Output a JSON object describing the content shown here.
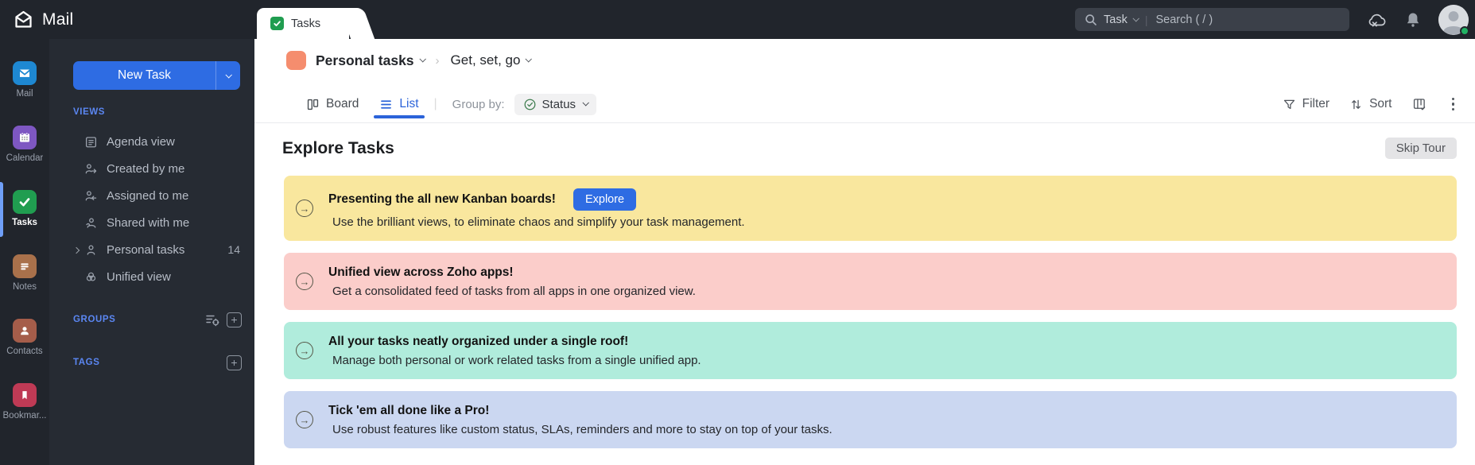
{
  "topbar": {
    "app_name": "Mail",
    "search": {
      "entity": "Task",
      "placeholder": "Search ( / )"
    }
  },
  "tab": {
    "label": "Tasks"
  },
  "rail": {
    "items": [
      {
        "label": "Mail",
        "color": "#1e88d2"
      },
      {
        "label": "Calendar",
        "color": "#7e57c2"
      },
      {
        "label": "Tasks",
        "color": "#209d50"
      },
      {
        "label": "Notes",
        "color": "#a9714b"
      },
      {
        "label": "Contacts",
        "color": "#a55d4a"
      },
      {
        "label": "Bookmar...",
        "color": "#bf3a55"
      }
    ]
  },
  "sidebar": {
    "new_task_label": "New Task",
    "views_label": "VIEWS",
    "views": [
      {
        "label": "Agenda view"
      },
      {
        "label": "Created by me"
      },
      {
        "label": "Assigned to me"
      },
      {
        "label": "Shared with me"
      },
      {
        "label": "Personal tasks",
        "count": "14"
      },
      {
        "label": "Unified view"
      }
    ],
    "groups_label": "GROUPS",
    "tags_label": "TAGS",
    "plus_glyph": "+"
  },
  "breadcrumb": {
    "list_name": "Personal tasks",
    "view_name": "Get, set, go",
    "separator": "›",
    "swatch_color": "#f58d6e"
  },
  "toolbar": {
    "board_label": "Board",
    "list_label": "List",
    "separator": "|",
    "group_by_label": "Group by:",
    "group_by_value": "Status",
    "filter_label": "Filter",
    "sort_label": "Sort"
  },
  "tour": {
    "heading": "Explore Tasks",
    "skip_label": "Skip Tour",
    "arrow_glyph": "→",
    "banners": [
      {
        "title": "Presenting the all new Kanban boards!",
        "subtitle": "Use the brilliant views, to eliminate chaos and simplify your task management.",
        "action_label": "Explore",
        "bg": "#f9e79e"
      },
      {
        "title": "Unified view across Zoho apps!",
        "subtitle": "Get a consolidated feed of tasks from all apps in one organized view.",
        "bg": "#fbcdca"
      },
      {
        "title": "All your tasks neatly organized under a single roof!",
        "subtitle": "Manage both personal or work related tasks from a single unified app.",
        "bg": "#b0ecdc"
      },
      {
        "title": "Tick 'em all done like a Pro!",
        "subtitle": "Use robust features like custom status, SLAs, reminders and more to stay on top of your tasks.",
        "bg": "#cbd7f1"
      }
    ]
  },
  "colors": {
    "accent": "#2e6ce3",
    "presence": "#21b263"
  }
}
